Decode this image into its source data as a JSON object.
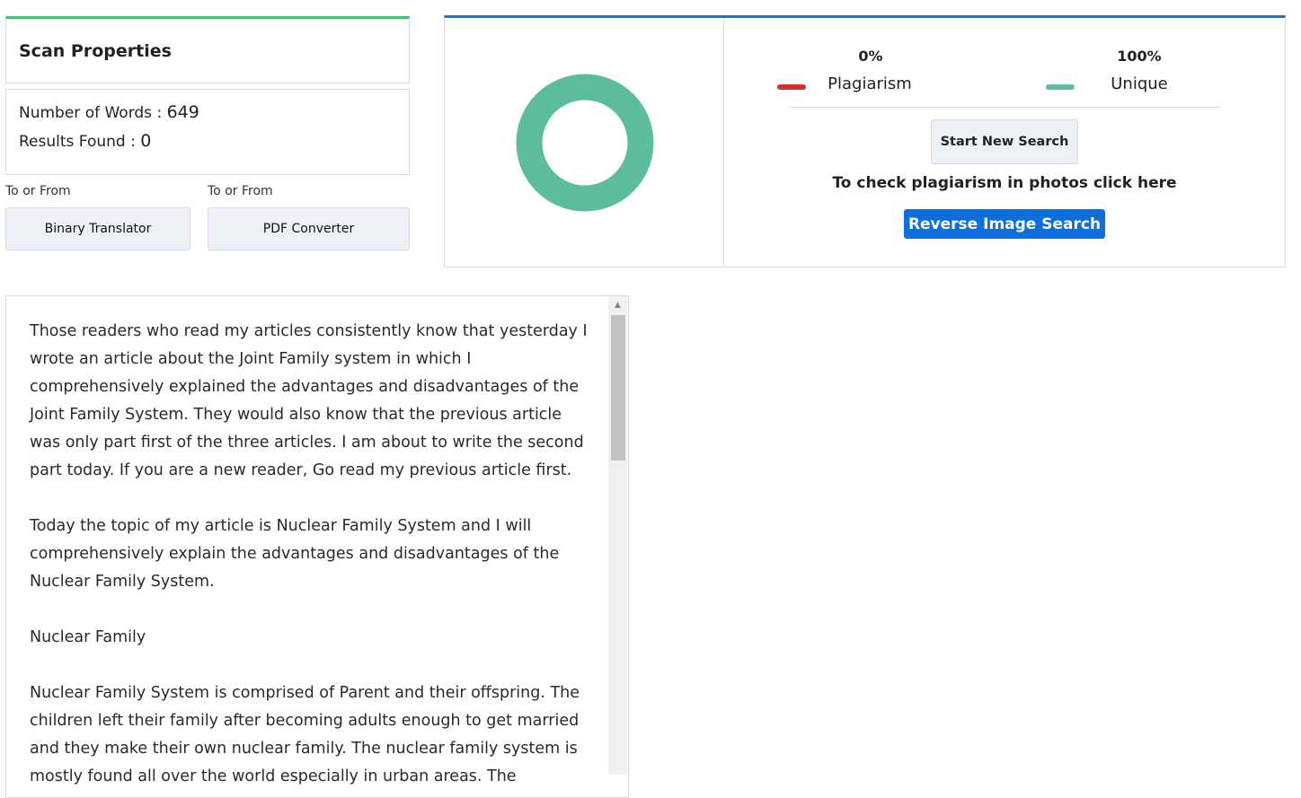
{
  "scan_properties": {
    "title": "Scan Properties",
    "words_label": "Number of Words :",
    "words_value": "649",
    "results_label": "Results Found :",
    "results_value": "0"
  },
  "tools": [
    {
      "caption": "To or From",
      "button": "Binary Translator"
    },
    {
      "caption": "To or From",
      "button": "PDF Converter"
    }
  ],
  "results": {
    "plagiarism_pct": "0%",
    "plagiarism_label": "Plagiarism",
    "unique_pct": "100%",
    "unique_label": "Unique",
    "unique_fraction": 1.0,
    "colors": {
      "plagiarism": "#d32f2f",
      "unique": "#5cbd9b"
    },
    "new_search_label": "Start New Search",
    "photo_hint": "To check plagiarism in photos click here",
    "reverse_image_label": "Reverse Image Search"
  },
  "content": {
    "paragraphs": [
      "Those readers who read my articles consistently know that yesterday I wrote an article about the Joint Family system in which I comprehensively explained the advantages and disadvantages of the Joint Family System. They would also know that the previous article was only part first of the three articles. I am about to write the second part today. If you are a new reader, Go read my previous article first.",
      "Today the topic of my article is Nuclear Family System and I will comprehensively explain the advantages and disadvantages of the Nuclear Family System.",
      "Nuclear Family",
      "Nuclear Family System is comprised of Parent and their offspring. The children left their family after becoming adults enough to get married and they make their own nuclear family. The nuclear family system is mostly found all over the world especially in urban areas. The"
    ]
  }
}
